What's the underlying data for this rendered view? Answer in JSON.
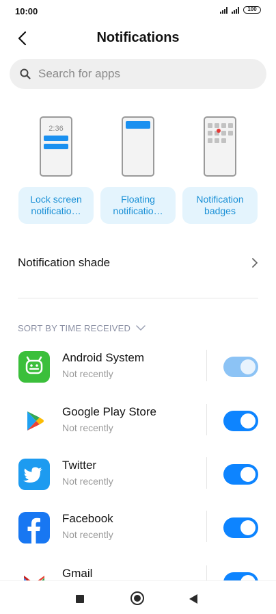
{
  "status_bar": {
    "time": "10:00",
    "battery": "100"
  },
  "header": {
    "title": "Notifications"
  },
  "search": {
    "placeholder": "Search for apps"
  },
  "styles": [
    {
      "label": "Lock screen notificatio…",
      "preview_time": "2:36"
    },
    {
      "label": "Floating notificatio…"
    },
    {
      "label": "Notification badges"
    }
  ],
  "shade": {
    "label": "Notification shade"
  },
  "sort": {
    "label": "SORT BY TIME RECEIVED"
  },
  "apps": [
    {
      "name": "Android System",
      "status": "Not recently",
      "enabled": true,
      "toggle_disabled": true
    },
    {
      "name": "Google Play Store",
      "status": "Not recently",
      "enabled": true
    },
    {
      "name": "Twitter",
      "status": "Not recently",
      "enabled": true
    },
    {
      "name": "Facebook",
      "status": "Not recently",
      "enabled": true
    },
    {
      "name": "Gmail",
      "status": "",
      "enabled": true
    }
  ],
  "colors": {
    "accent": "#0d84ff",
    "style_button_bg": "#e4f4fd",
    "style_button_text": "#1a90d6",
    "android_green": "#3bbf3b",
    "twitter_blue": "#1d9bf0",
    "facebook_blue": "#1877f2"
  }
}
